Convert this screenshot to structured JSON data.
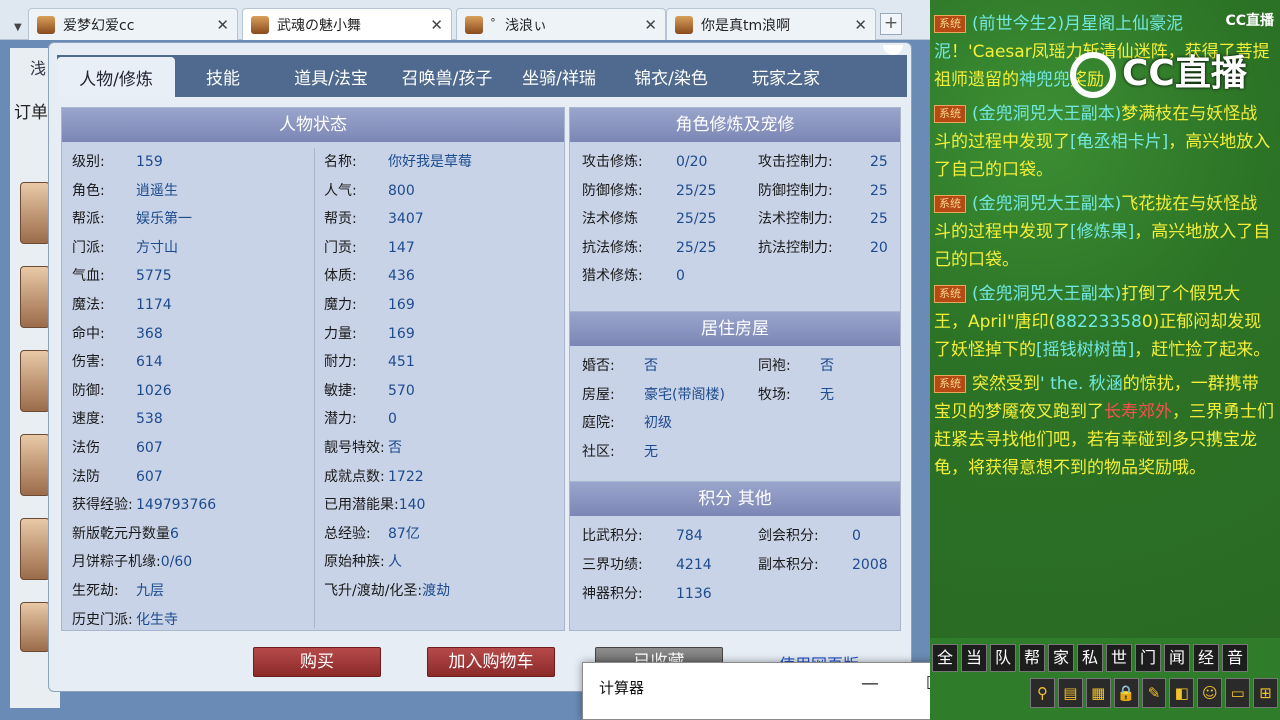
{
  "browser_tabs": [
    {
      "title": "爱梦幻爱cc",
      "active": false
    },
    {
      "title": "武魂の魅小舞",
      "active": true
    },
    {
      "title": "゜浅浪ぃ",
      "active": false
    },
    {
      "title": "你是真tm浪啊",
      "active": false
    }
  ],
  "new_tab_label": "+",
  "underlay": {
    "label1": "浅",
    "label2": "订单"
  },
  "window": {
    "tabs": [
      "人物/修炼",
      "技能",
      "道具/法宝",
      "召唤兽/孩子",
      "坐骑/祥瑞",
      "锦衣/染色",
      "玩家之家"
    ],
    "status_panel": {
      "title": "人物状态",
      "left": [
        {
          "k": "级别:",
          "v": "159"
        },
        {
          "k": "角色:",
          "v": "逍遥生"
        },
        {
          "k": "帮派:",
          "v": "娱乐第一"
        },
        {
          "k": "门派:",
          "v": "方寸山"
        },
        {
          "k": "气血:",
          "v": "5775"
        },
        {
          "k": "魔法:",
          "v": "1174"
        },
        {
          "k": "命中:",
          "v": "368"
        },
        {
          "k": "伤害:",
          "v": "614"
        },
        {
          "k": "防御:",
          "v": "1026"
        },
        {
          "k": "速度:",
          "v": "538"
        },
        {
          "k": "法伤",
          "v": "607"
        },
        {
          "k": "法防",
          "v": "607"
        },
        {
          "k": "获得经验:",
          "v": "149793766"
        },
        {
          "k": "新版乾元丹数量",
          "v": "6"
        },
        {
          "k": "月饼粽子机缘:",
          "v": "0/60"
        },
        {
          "k": "生死劫:",
          "v": "九层"
        },
        {
          "k": "历史门派:",
          "v": "化生寺"
        }
      ],
      "right": [
        {
          "k": "名称:",
          "v": "你好我是草莓"
        },
        {
          "k": "人气:",
          "v": "800"
        },
        {
          "k": "帮贡:",
          "v": "3407"
        },
        {
          "k": "门贡:",
          "v": "147"
        },
        {
          "k": "体质:",
          "v": "436"
        },
        {
          "k": "魔力:",
          "v": "169"
        },
        {
          "k": "力量:",
          "v": "169"
        },
        {
          "k": "耐力:",
          "v": "451"
        },
        {
          "k": "敏捷:",
          "v": "570"
        },
        {
          "k": "潜力:",
          "v": "0"
        },
        {
          "k": "靓号特效:",
          "v": "否"
        },
        {
          "k": "成就点数:",
          "v": "1722"
        },
        {
          "k": "已用潜能果:",
          "v": "140"
        },
        {
          "k": "总经验:",
          "v": "87亿"
        },
        {
          "k": "原始种族:",
          "v": "人"
        },
        {
          "k": "飞升/渡劫/化圣:",
          "v": "渡劫"
        }
      ]
    },
    "cultivation_panel": {
      "title": "角色修炼及宠修",
      "left": [
        {
          "k": "攻击修炼:",
          "v": "0/20"
        },
        {
          "k": "防御修炼:",
          "v": "25/25"
        },
        {
          "k": "法术修炼",
          "v": "25/25"
        },
        {
          "k": "抗法修炼:",
          "v": "25/25"
        },
        {
          "k": "猎术修炼:",
          "v": "0"
        }
      ],
      "right": [
        {
          "k": "攻击控制力:",
          "v": "25"
        },
        {
          "k": "防御控制力:",
          "v": "25"
        },
        {
          "k": "法术控制力:",
          "v": "25"
        },
        {
          "k": "抗法控制力:",
          "v": "20"
        }
      ]
    },
    "house_panel": {
      "title": "居住房屋",
      "left": [
        {
          "k": "婚否:",
          "v": "否"
        },
        {
          "k": "房屋:",
          "v": "豪宅(带阁楼)"
        },
        {
          "k": "庭院:",
          "v": "初级"
        },
        {
          "k": "社区:",
          "v": "无"
        }
      ],
      "right": [
        {
          "k": "同袍:",
          "v": "否"
        },
        {
          "k": "牧场:",
          "v": "无"
        }
      ]
    },
    "points_panel": {
      "title": "积分 其他",
      "left": [
        {
          "k": "比武积分:",
          "v": "784"
        },
        {
          "k": "三界功绩:",
          "v": "4214"
        },
        {
          "k": "神器积分:",
          "v": "1136"
        }
      ],
      "right": [
        {
          "k": "剑会积分:",
          "v": "0"
        },
        {
          "k": "副本积分:",
          "v": "2008"
        }
      ]
    },
    "buttons": {
      "buy": "购买",
      "add_cart": "加入购物车",
      "collected": "已收藏",
      "web_version": "使用网页版"
    }
  },
  "calculator": {
    "title": "计算器",
    "minimize": "—",
    "maximize": "☐",
    "close": "✕"
  },
  "chat": {
    "logo_small": "CC直播",
    "logo_big": "CC直播",
    "messages": [
      {
        "tag": "系统",
        "parts": [
          {
            "t": "(前世今生2)月星阁上仙豪泥泥",
            "cls": "c"
          },
          {
            "t": "！'Caesar凤瑶力斩清仙迷阵，获得了菩提祖师遗留的",
            "cls": "y"
          },
          {
            "t": "神兜兜",
            "cls": "c"
          },
          {
            "t": "奖励",
            "cls": "y"
          }
        ]
      },
      {
        "tag": "系统",
        "parts": [
          {
            "t": "(金兜洞兕大王副本)",
            "cls": "c"
          },
          {
            "t": "梦满枝",
            "cls": "y"
          },
          {
            "t": "在与妖怪战斗的过程中发现了",
            "cls": "y"
          },
          {
            "t": "[龟丞相卡片]",
            "cls": "c"
          },
          {
            "t": "，高兴地放入了自己的口袋。",
            "cls": "y"
          }
        ]
      },
      {
        "tag": "系统",
        "parts": [
          {
            "t": "(金兜洞兕大王副本)",
            "cls": "c"
          },
          {
            "t": "飞花拢",
            "cls": "y"
          },
          {
            "t": "在与妖怪战斗的过程中发现了",
            "cls": "y"
          },
          {
            "t": "[修炼果]",
            "cls": "c"
          },
          {
            "t": "，高兴地放入了自己的口袋。",
            "cls": "y"
          }
        ]
      },
      {
        "tag": "系统",
        "parts": [
          {
            "t": "(金兜洞兕大王副本)",
            "cls": "c"
          },
          {
            "t": "打倒了个假兕大王，",
            "cls": "y"
          },
          {
            "t": "April\"唐印(",
            "cls": "y"
          },
          {
            "t": "88223358",
            "cls": "c"
          },
          {
            "t": "0)正郁闷却发现了妖怪掉下的",
            "cls": "y"
          },
          {
            "t": "[摇钱树树苗]",
            "cls": "c"
          },
          {
            "t": "，赶忙捡了起来。",
            "cls": "y"
          }
        ]
      },
      {
        "tag": "系统",
        "parts": [
          {
            "t": "突然受到",
            "cls": "y"
          },
          {
            "t": "' the. 秋涵",
            "cls": "c"
          },
          {
            "t": "的惊扰，一群携带宝贝的梦魇夜叉跑到了",
            "cls": "y"
          },
          {
            "t": "长寿郊外",
            "cls": "r"
          },
          {
            "t": "，三界勇士们赶紧去寻找他们吧，若有幸碰到多只携宝龙龟，将获得意想不到的物品奖励哦",
            "cls": "y"
          },
          {
            "t": "。",
            "cls": "y"
          }
        ]
      }
    ],
    "bar1": [
      "全",
      "当",
      "队",
      "帮",
      "家",
      "私",
      "世",
      "门",
      "闻",
      "经",
      "音"
    ],
    "bar2": [
      "⚲",
      "▤",
      "▦",
      "🔒",
      "✎",
      "◧",
      "☺",
      "▭",
      "⊞"
    ]
  }
}
